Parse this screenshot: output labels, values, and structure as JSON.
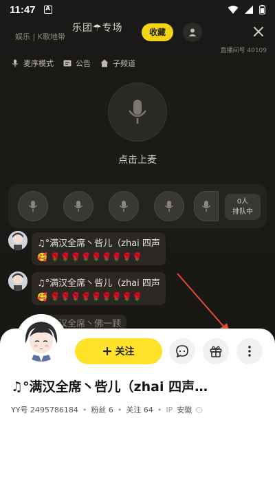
{
  "status": {
    "time": "11:47",
    "a_badge": "A"
  },
  "room": {
    "tag": "娱乐 | K歌地带",
    "title": "乐团☂专场",
    "favorite_label": "收藏",
    "room_id": "直播间号 40109",
    "chips": [
      "麦序模式",
      "公告",
      "子频道"
    ],
    "host_label": "点击上麦",
    "queue_count": "0人",
    "queue_label": "排队中"
  },
  "chat": {
    "messages": [
      {
        "text": "♫°满汉全席丶呰儿（zhai 四声",
        "emojis": "🥰 🌹🌹🌹🌹🌹🌹🌹🌹🌹"
      },
      {
        "text": "♫°满汉全席丶呰儿（zhai 四声",
        "emojis": "🥰 🌹🌹🌹🌹🌹🌹🌹🌹🌹"
      },
      {
        "text": "♫°满汉全席丶佛一顾"
      }
    ]
  },
  "profile": {
    "follow_label": "关注",
    "name": "♫°满汉全席丶呰儿（zhai 四声…",
    "yy_label": "YY号 2495786184",
    "fans": "粉丝 6",
    "following": "关注 64",
    "ip_label": "IP",
    "ip_value": "安徽"
  },
  "colors": {
    "accent": "#ffe229",
    "favorite": "#f3d516",
    "arrow": "#e34a33"
  },
  "icons": [
    "mic-icon",
    "gift-icon",
    "chat-bubble-icon",
    "more-icon",
    "close-icon",
    "user-icon"
  ]
}
